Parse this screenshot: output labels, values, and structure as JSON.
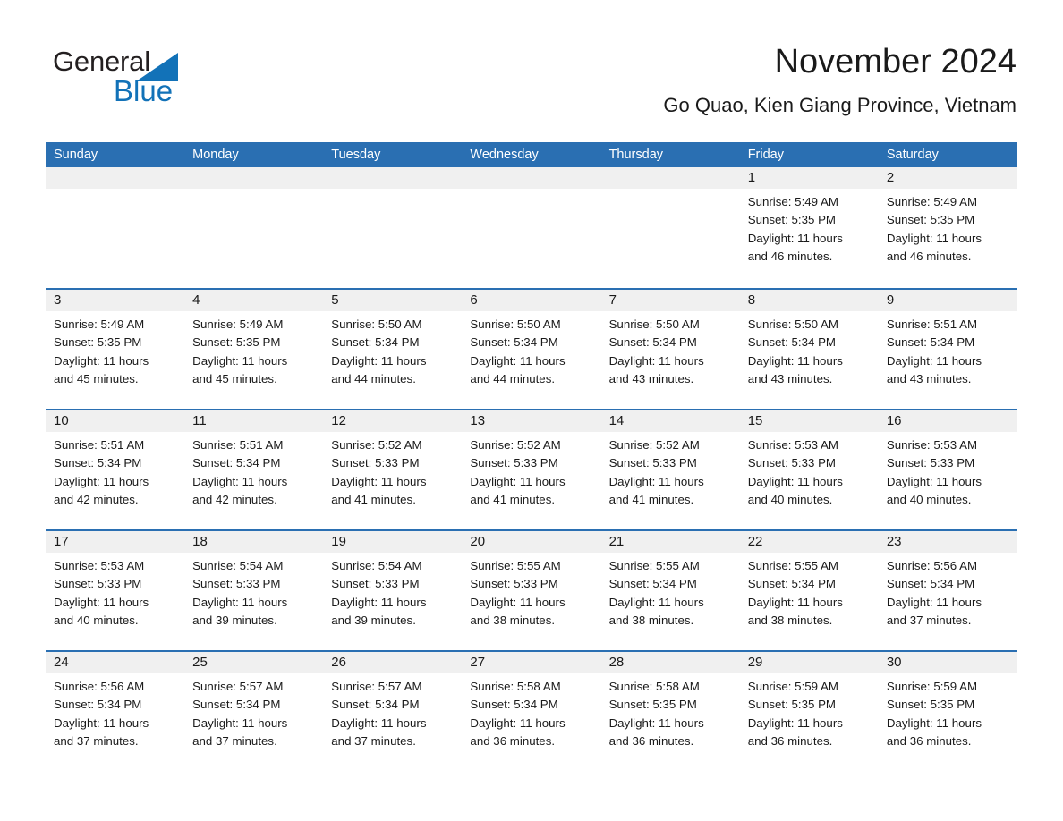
{
  "brand": {
    "name_part1": "General",
    "name_part2": "Blue",
    "accent_color": "#1272b8"
  },
  "header": {
    "month_title": "November 2024",
    "location": "Go Quao, Kien Giang Province, Vietnam"
  },
  "theme": {
    "header_blue": "#2a6fb2",
    "day_band_gray": "#f0f0f0",
    "text_color": "#1a1a1a"
  },
  "weekdays": [
    "Sunday",
    "Monday",
    "Tuesday",
    "Wednesday",
    "Thursday",
    "Friday",
    "Saturday"
  ],
  "labels": {
    "sunrise_prefix": "Sunrise:",
    "sunset_prefix": "Sunset:",
    "daylight_prefix": "Daylight:"
  },
  "weeks": [
    [
      {
        "day": "",
        "empty": true
      },
      {
        "day": "",
        "empty": true
      },
      {
        "day": "",
        "empty": true
      },
      {
        "day": "",
        "empty": true
      },
      {
        "day": "",
        "empty": true
      },
      {
        "day": "1",
        "sunrise": "Sunrise: 5:49 AM",
        "sunset": "Sunset: 5:35 PM",
        "daylight_l1": "Daylight: 11 hours",
        "daylight_l2": "and 46 minutes."
      },
      {
        "day": "2",
        "sunrise": "Sunrise: 5:49 AM",
        "sunset": "Sunset: 5:35 PM",
        "daylight_l1": "Daylight: 11 hours",
        "daylight_l2": "and 46 minutes."
      }
    ],
    [
      {
        "day": "3",
        "sunrise": "Sunrise: 5:49 AM",
        "sunset": "Sunset: 5:35 PM",
        "daylight_l1": "Daylight: 11 hours",
        "daylight_l2": "and 45 minutes."
      },
      {
        "day": "4",
        "sunrise": "Sunrise: 5:49 AM",
        "sunset": "Sunset: 5:35 PM",
        "daylight_l1": "Daylight: 11 hours",
        "daylight_l2": "and 45 minutes."
      },
      {
        "day": "5",
        "sunrise": "Sunrise: 5:50 AM",
        "sunset": "Sunset: 5:34 PM",
        "daylight_l1": "Daylight: 11 hours",
        "daylight_l2": "and 44 minutes."
      },
      {
        "day": "6",
        "sunrise": "Sunrise: 5:50 AM",
        "sunset": "Sunset: 5:34 PM",
        "daylight_l1": "Daylight: 11 hours",
        "daylight_l2": "and 44 minutes."
      },
      {
        "day": "7",
        "sunrise": "Sunrise: 5:50 AM",
        "sunset": "Sunset: 5:34 PM",
        "daylight_l1": "Daylight: 11 hours",
        "daylight_l2": "and 43 minutes."
      },
      {
        "day": "8",
        "sunrise": "Sunrise: 5:50 AM",
        "sunset": "Sunset: 5:34 PM",
        "daylight_l1": "Daylight: 11 hours",
        "daylight_l2": "and 43 minutes."
      },
      {
        "day": "9",
        "sunrise": "Sunrise: 5:51 AM",
        "sunset": "Sunset: 5:34 PM",
        "daylight_l1": "Daylight: 11 hours",
        "daylight_l2": "and 43 minutes."
      }
    ],
    [
      {
        "day": "10",
        "sunrise": "Sunrise: 5:51 AM",
        "sunset": "Sunset: 5:34 PM",
        "daylight_l1": "Daylight: 11 hours",
        "daylight_l2": "and 42 minutes."
      },
      {
        "day": "11",
        "sunrise": "Sunrise: 5:51 AM",
        "sunset": "Sunset: 5:34 PM",
        "daylight_l1": "Daylight: 11 hours",
        "daylight_l2": "and 42 minutes."
      },
      {
        "day": "12",
        "sunrise": "Sunrise: 5:52 AM",
        "sunset": "Sunset: 5:33 PM",
        "daylight_l1": "Daylight: 11 hours",
        "daylight_l2": "and 41 minutes."
      },
      {
        "day": "13",
        "sunrise": "Sunrise: 5:52 AM",
        "sunset": "Sunset: 5:33 PM",
        "daylight_l1": "Daylight: 11 hours",
        "daylight_l2": "and 41 minutes."
      },
      {
        "day": "14",
        "sunrise": "Sunrise: 5:52 AM",
        "sunset": "Sunset: 5:33 PM",
        "daylight_l1": "Daylight: 11 hours",
        "daylight_l2": "and 41 minutes."
      },
      {
        "day": "15",
        "sunrise": "Sunrise: 5:53 AM",
        "sunset": "Sunset: 5:33 PM",
        "daylight_l1": "Daylight: 11 hours",
        "daylight_l2": "and 40 minutes."
      },
      {
        "day": "16",
        "sunrise": "Sunrise: 5:53 AM",
        "sunset": "Sunset: 5:33 PM",
        "daylight_l1": "Daylight: 11 hours",
        "daylight_l2": "and 40 minutes."
      }
    ],
    [
      {
        "day": "17",
        "sunrise": "Sunrise: 5:53 AM",
        "sunset": "Sunset: 5:33 PM",
        "daylight_l1": "Daylight: 11 hours",
        "daylight_l2": "and 40 minutes."
      },
      {
        "day": "18",
        "sunrise": "Sunrise: 5:54 AM",
        "sunset": "Sunset: 5:33 PM",
        "daylight_l1": "Daylight: 11 hours",
        "daylight_l2": "and 39 minutes."
      },
      {
        "day": "19",
        "sunrise": "Sunrise: 5:54 AM",
        "sunset": "Sunset: 5:33 PM",
        "daylight_l1": "Daylight: 11 hours",
        "daylight_l2": "and 39 minutes."
      },
      {
        "day": "20",
        "sunrise": "Sunrise: 5:55 AM",
        "sunset": "Sunset: 5:33 PM",
        "daylight_l1": "Daylight: 11 hours",
        "daylight_l2": "and 38 minutes."
      },
      {
        "day": "21",
        "sunrise": "Sunrise: 5:55 AM",
        "sunset": "Sunset: 5:34 PM",
        "daylight_l1": "Daylight: 11 hours",
        "daylight_l2": "and 38 minutes."
      },
      {
        "day": "22",
        "sunrise": "Sunrise: 5:55 AM",
        "sunset": "Sunset: 5:34 PM",
        "daylight_l1": "Daylight: 11 hours",
        "daylight_l2": "and 38 minutes."
      },
      {
        "day": "23",
        "sunrise": "Sunrise: 5:56 AM",
        "sunset": "Sunset: 5:34 PM",
        "daylight_l1": "Daylight: 11 hours",
        "daylight_l2": "and 37 minutes."
      }
    ],
    [
      {
        "day": "24",
        "sunrise": "Sunrise: 5:56 AM",
        "sunset": "Sunset: 5:34 PM",
        "daylight_l1": "Daylight: 11 hours",
        "daylight_l2": "and 37 minutes."
      },
      {
        "day": "25",
        "sunrise": "Sunrise: 5:57 AM",
        "sunset": "Sunset: 5:34 PM",
        "daylight_l1": "Daylight: 11 hours",
        "daylight_l2": "and 37 minutes."
      },
      {
        "day": "26",
        "sunrise": "Sunrise: 5:57 AM",
        "sunset": "Sunset: 5:34 PM",
        "daylight_l1": "Daylight: 11 hours",
        "daylight_l2": "and 37 minutes."
      },
      {
        "day": "27",
        "sunrise": "Sunrise: 5:58 AM",
        "sunset": "Sunset: 5:34 PM",
        "daylight_l1": "Daylight: 11 hours",
        "daylight_l2": "and 36 minutes."
      },
      {
        "day": "28",
        "sunrise": "Sunrise: 5:58 AM",
        "sunset": "Sunset: 5:35 PM",
        "daylight_l1": "Daylight: 11 hours",
        "daylight_l2": "and 36 minutes."
      },
      {
        "day": "29",
        "sunrise": "Sunrise: 5:59 AM",
        "sunset": "Sunset: 5:35 PM",
        "daylight_l1": "Daylight: 11 hours",
        "daylight_l2": "and 36 minutes."
      },
      {
        "day": "30",
        "sunrise": "Sunrise: 5:59 AM",
        "sunset": "Sunset: 5:35 PM",
        "daylight_l1": "Daylight: 11 hours",
        "daylight_l2": "and 36 minutes."
      }
    ]
  ]
}
